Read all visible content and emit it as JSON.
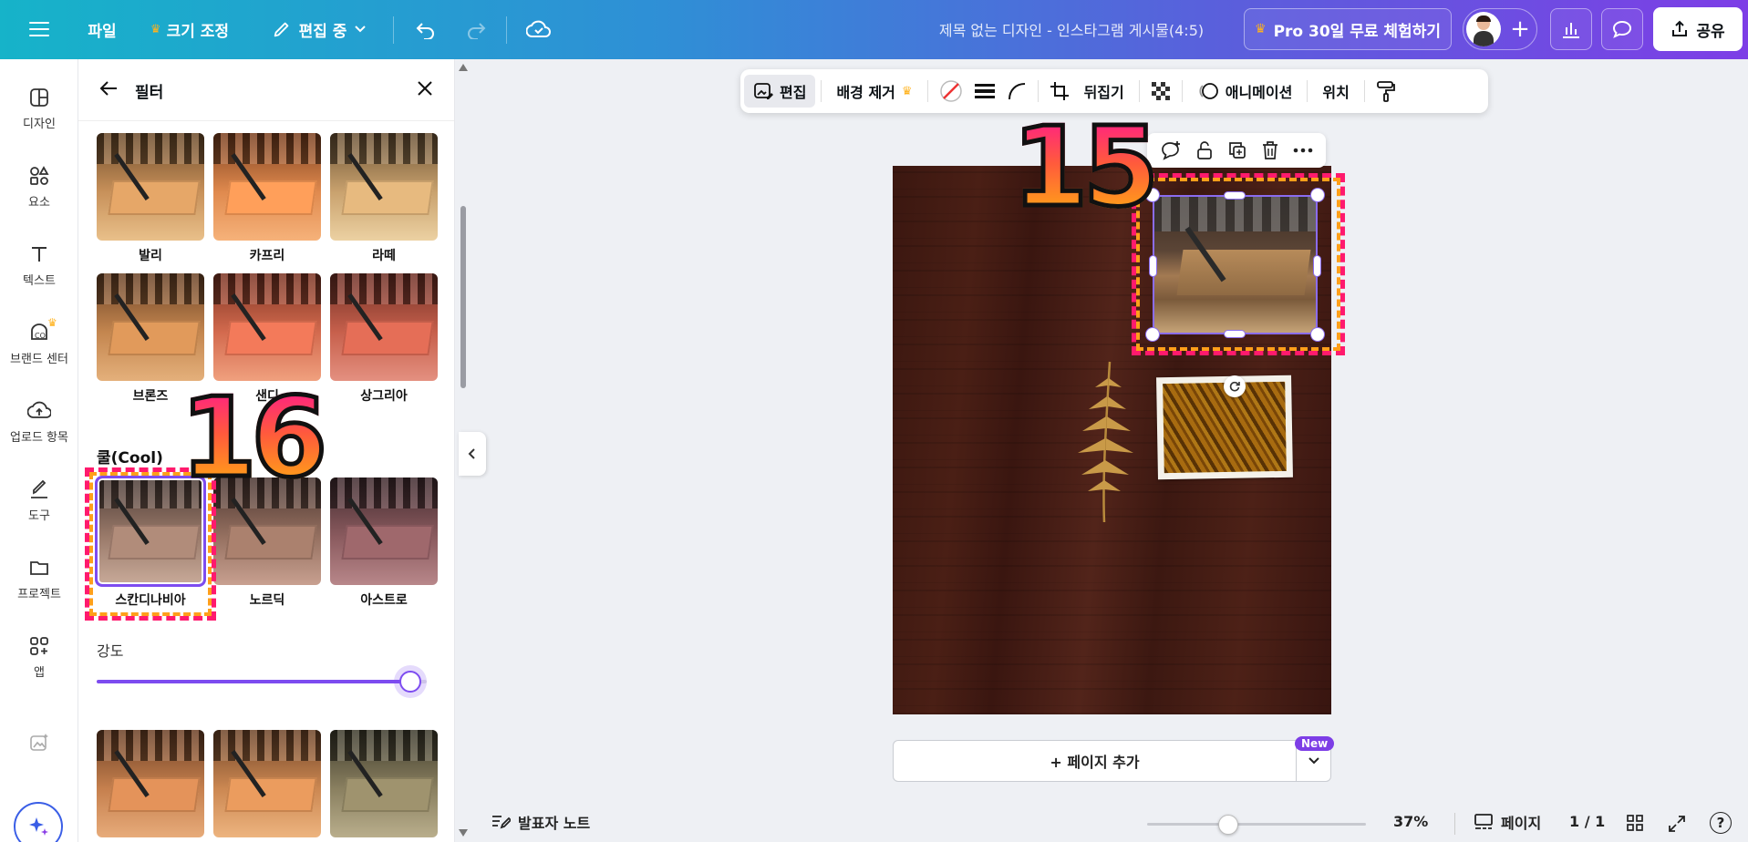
{
  "topbar": {
    "menu_icon": "hamburger-icon",
    "file": "파일",
    "resize": "크기 조정",
    "edit_mode": "편집 중",
    "doc_title": "제목 없는 디자인 - 인스타그램 게시물(4:5)",
    "pro_trial": "Pro 30일 무료 체험하기",
    "share": "공유",
    "colors": {
      "gradient_start": "#16b3c9",
      "gradient_end": "#7d3ee6",
      "crown": "#ffb21d"
    }
  },
  "rail": {
    "items": [
      {
        "label": "디자인",
        "icon": "design-icon"
      },
      {
        "label": "요소",
        "icon": "elements-icon"
      },
      {
        "label": "텍스트",
        "icon": "text-icon"
      },
      {
        "label": "브랜드 센터",
        "icon": "brand-icon"
      },
      {
        "label": "업로드 항목",
        "icon": "upload-icon"
      },
      {
        "label": "도구",
        "icon": "draw-icon"
      },
      {
        "label": "프로젝트",
        "icon": "folder-icon"
      },
      {
        "label": "앱",
        "icon": "apps-icon"
      }
    ]
  },
  "panel": {
    "title": "필터",
    "filters_row1": [
      "발리",
      "카프리",
      "라떼"
    ],
    "filters_row2": [
      "브론즈",
      "샌디",
      "상그리아"
    ],
    "cool_section": "쿨(Cool)",
    "filters_cool": [
      "스칸디나비아",
      "노르딕",
      "아스트로"
    ],
    "selected_filter": "스칸디나비아",
    "intensity_label": "강도",
    "intensity_value": 1.0
  },
  "annotations": {
    "step_a": "15",
    "step_b": "16"
  },
  "context_toolbar": {
    "edit": "편집",
    "bg_remove": "배경 제거",
    "flip": "뒤집기",
    "animation": "애니메이션",
    "position": "위치"
  },
  "canvas": {
    "add_page": "+ 페이지 추가",
    "new_badge": "New"
  },
  "bottombar": {
    "notes": "발표자 노트",
    "zoom": "37%",
    "zoom_level": 0.37,
    "pages_label": "페이지",
    "page_count": "1 / 1"
  }
}
